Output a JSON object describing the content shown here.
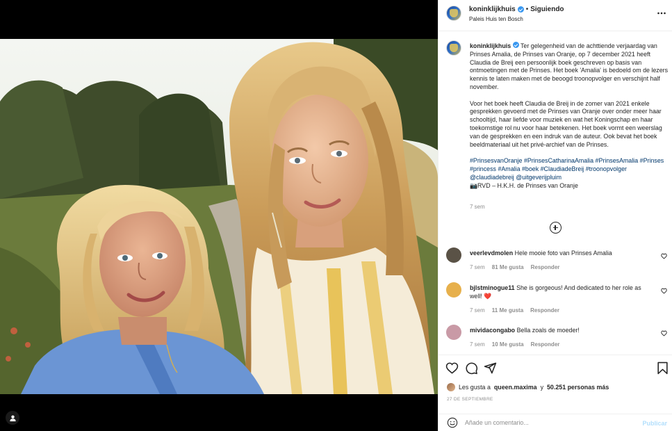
{
  "post": {
    "username": "koninklijkhuis",
    "separator": "•",
    "follow_status": "Siguiendo",
    "location": "Paleis Huis ten Bosch",
    "more_icon": "more-horizontal-icon",
    "caption_username": "koninklijkhuis",
    "caption_p1": "Ter gelegenheid van de achttiende verjaardag van Prinses Amalia, de Prinses van Oranje, op 7 december 2021 heeft Claudia de Breij een persoonlijk boek geschreven op basis van ontmoetingen met de Prinses. Het boek 'Amalia' is bedoeld om de lezers kennis te laten maken met de beoogd troonopvolger en verschijnt half november.",
    "caption_p2": "Voor het boek heeft Claudia de Breij in de zomer van 2021 enkele gesprekken gevoerd met de Prinses van Oranje over onder meer haar schooltijd, haar liefde voor muziek en wat het Koningschap en haar toekomstige rol nu voor haar betekenen. Het boek vormt een weerslag van de gesprekken en een indruk van de auteur. Ook bevat het boek beeldmateriaal uit het privé-archief van de Prinses.",
    "hashtags": "#PrinsesvanOranje #PrinsesCatharinaAmalia #PrinsesAmalia #Prinses #princess #Amalia #boek #ClaudiadeBreij #troonopvolger @claudiadebreij @uitgeverijpluim",
    "credit": "📷RVD – H.K.H. de Prinses van Oranje",
    "time": "7 sem"
  },
  "comments": [
    {
      "user": "veerlevdmolen",
      "text": "Hele mooie foto van Prinses Amalia",
      "time": "7 sem",
      "likes": "81 Me gusta",
      "reply": "Responder",
      "avatar_color": "#5a5246"
    },
    {
      "user": "bjlstminogue11",
      "text": "She is gorgeous! And dedicated to her role as well! ❤️",
      "time": "7 sem",
      "likes": "11 Me gusta",
      "reply": "Responder",
      "avatar_color": "#e7b04c"
    },
    {
      "user": "mividacongabo",
      "text": "Bella zoals de moeder!",
      "time": "7 sem",
      "likes": "10 Me gusta",
      "reply": "Responder",
      "avatar_color": "#c99aa6"
    }
  ],
  "likes": {
    "prefix": "Les gusta a",
    "user": "queen.maxima",
    "middle": "y",
    "count": "50.251 personas más"
  },
  "date": "27 DE SEPTIEMBRE",
  "comment_box": {
    "placeholder": "Añade un comentario...",
    "publish": "Publicar"
  },
  "colors": {
    "link": "#00376b",
    "verified": "#3897f0",
    "muted": "#8e8e8e",
    "publish_disabled": "#b2dffc"
  },
  "icons": [
    "heart-icon",
    "comment-icon",
    "share-icon",
    "bookmark-icon",
    "emoji-icon",
    "add-circle-icon",
    "tag-user-icon",
    "verified-badge-icon"
  ]
}
